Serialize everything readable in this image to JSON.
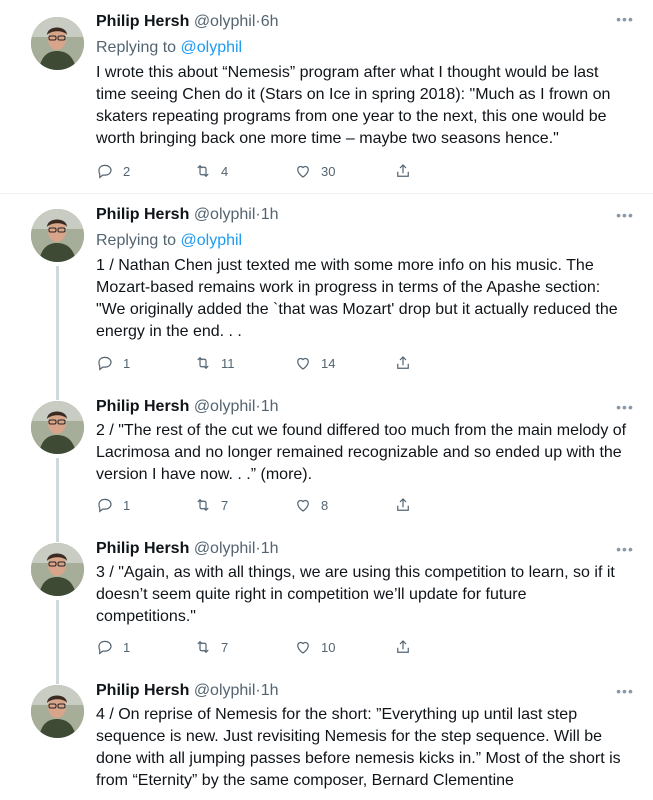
{
  "tweets": [
    {
      "name": "Philip Hersh",
      "handle": "@olyphil",
      "dot": "·",
      "time": "6h",
      "replying_prefix": "Replying to ",
      "replying_handle": "@olyphil",
      "text": "I wrote this about “Nemesis” program after what I thought would be last time seeing Chen do it (Stars on Ice in spring 2018): \"Much as I frown on skaters repeating programs from one year to the next, this one would be worth bringing back one more time – maybe two seasons hence.\"",
      "replies": "2",
      "retweets": "4",
      "likes": "30"
    },
    {
      "name": "Philip Hersh",
      "handle": "@olyphil",
      "dot": "·",
      "time": "1h",
      "replying_prefix": "Replying to ",
      "replying_handle": "@olyphil",
      "text": "1 / Nathan Chen just texted me with some more info on his music.  The Mozart-based remains work in progress in terms of the Apashe section: \"We originally added the `that was Mozart' drop but it actually reduced the energy in the end. . .",
      "replies": "1",
      "retweets": "11",
      "likes": "14"
    },
    {
      "name": "Philip Hersh",
      "handle": "@olyphil",
      "dot": "·",
      "time": "1h",
      "text": "2 / \"The rest of the cut we found differed too much from the main melody of Lacrimosa and no longer remained recognizable and so ended up with the version I have now. . .” (more).",
      "replies": "1",
      "retweets": "7",
      "likes": "8"
    },
    {
      "name": "Philip Hersh",
      "handle": "@olyphil",
      "dot": "·",
      "time": "1h",
      "text": "3 / \"Again, as with all things, we are using this competition to learn, so if it doesn’t seem quite right in competition we’ll update for future competitions.\"",
      "replies": "1",
      "retweets": "7",
      "likes": "10"
    },
    {
      "name": "Philip Hersh",
      "handle": "@olyphil",
      "dot": "·",
      "time": "1h",
      "text": "4 / On reprise of Nemesis for the short:  ”Everything up until last step sequence is new. Just revisiting Nemesis for the step sequence. Will be done with all jumping passes before nemesis kicks in.”  Most of the short is from “Eternity” by the same composer, Bernard Clementine"
    }
  ],
  "icons": {
    "reply": "reply-icon",
    "retweet": "retweet-icon",
    "like": "heart-icon",
    "share": "share-icon",
    "more": "more-icon"
  },
  "colors": {
    "link": "#1d9bf0",
    "secondary_text": "#536471",
    "thread_line": "#cfd9de"
  }
}
